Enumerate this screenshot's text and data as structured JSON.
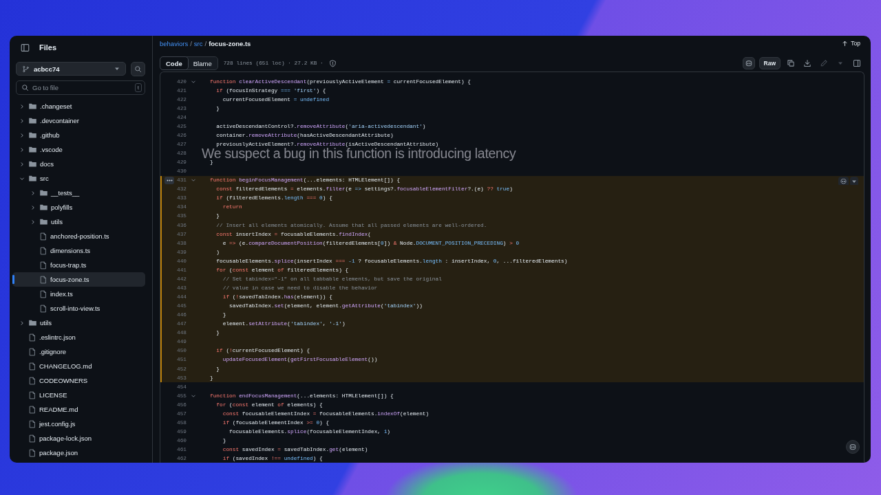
{
  "sidebar": {
    "title": "Files",
    "branch": "acbcc74",
    "search": {
      "placeholder": "Go to file"
    },
    "shortcut": "t",
    "tree": [
      {
        "name": ".changeset",
        "kind": "folder",
        "expanded": false,
        "selected": false
      },
      {
        "name": ".devcontainer",
        "kind": "folder",
        "expanded": false,
        "selected": false
      },
      {
        "name": ".github",
        "kind": "folder",
        "expanded": false,
        "selected": false
      },
      {
        "name": ".vscode",
        "kind": "folder",
        "expanded": false,
        "selected": false
      },
      {
        "name": "docs",
        "kind": "folder",
        "expanded": false,
        "selected": false
      },
      {
        "name": "src",
        "kind": "folder",
        "expanded": true,
        "selected": false,
        "children": [
          {
            "name": "__tests__",
            "kind": "folder",
            "expanded": false,
            "selected": false
          },
          {
            "name": "polyfills",
            "kind": "folder",
            "expanded": false,
            "selected": false
          },
          {
            "name": "utils",
            "kind": "folder",
            "expanded": false,
            "selected": false
          },
          {
            "name": "anchored-position.ts",
            "kind": "file",
            "selected": false
          },
          {
            "name": "dimensions.ts",
            "kind": "file",
            "selected": false
          },
          {
            "name": "focus-trap.ts",
            "kind": "file",
            "selected": false
          },
          {
            "name": "focus-zone.ts",
            "kind": "file",
            "selected": true
          },
          {
            "name": "index.ts",
            "kind": "file",
            "selected": false
          },
          {
            "name": "scroll-into-view.ts",
            "kind": "file",
            "selected": false
          }
        ]
      },
      {
        "name": "utils",
        "kind": "folder",
        "expanded": false,
        "selected": false
      },
      {
        "name": ".eslintrc.json",
        "kind": "file",
        "selected": false
      },
      {
        "name": ".gitignore",
        "kind": "file",
        "selected": false
      },
      {
        "name": "CHANGELOG.md",
        "kind": "file",
        "selected": false
      },
      {
        "name": "CODEOWNERS",
        "kind": "file",
        "selected": false
      },
      {
        "name": "LICENSE",
        "kind": "file",
        "selected": false
      },
      {
        "name": "README.md",
        "kind": "file",
        "selected": false
      },
      {
        "name": "jest.config.js",
        "kind": "file",
        "selected": false
      },
      {
        "name": "package-lock.json",
        "kind": "file",
        "selected": false
      },
      {
        "name": "package.json",
        "kind": "file",
        "selected": false
      }
    ]
  },
  "breadcrumb": [
    {
      "text": "behaviors",
      "kind": "link"
    },
    {
      "text": "/",
      "kind": "sep"
    },
    {
      "text": "src",
      "kind": "link"
    },
    {
      "text": "/",
      "kind": "sep"
    },
    {
      "text": "focus-zone.ts",
      "kind": "current"
    }
  ],
  "top_link": "Top",
  "toolbar": {
    "tabs": [
      {
        "label": "Code",
        "selected": true
      },
      {
        "label": "Blame",
        "selected": false
      }
    ],
    "file_info": "728 lines (651 loc) · 27.2 KB ·",
    "raw_button": "Raw",
    "edit_disabled": true
  },
  "code": {
    "caption": "We suspect a bug in this function is introducing latency",
    "lines": [
      {
        "number": "420",
        "foldable": true,
        "highlighted": false,
        "tokens": [
          {
            "text": "function ",
            "kind": "keyword"
          },
          {
            "text": "clearActiveDescendant",
            "kind": "func"
          },
          {
            "text": "(previouslyActiveElement ",
            "kind": "plain"
          },
          {
            "text": "= ",
            "kind": "const"
          },
          {
            "text": "currentFocusedElement) {",
            "kind": "plain"
          }
        ]
      },
      {
        "number": "421",
        "foldable": false,
        "highlighted": false,
        "tokens": [
          {
            "text": "  if",
            "kind": "keyword"
          },
          {
            "text": " (focusInStrategy ",
            "kind": "plain"
          },
          {
            "text": "=== ",
            "kind": "const"
          },
          {
            "text": "'first'",
            "kind": "string"
          },
          {
            "text": ") {",
            "kind": "plain"
          }
        ]
      },
      {
        "number": "422",
        "foldable": false,
        "highlighted": false,
        "tokens": [
          {
            "text": "    currentFocusedElement ",
            "kind": "plain"
          },
          {
            "text": "= undefined",
            "kind": "const"
          }
        ]
      },
      {
        "number": "423",
        "foldable": false,
        "highlighted": false,
        "tokens": [
          {
            "text": "  }",
            "kind": "plain"
          }
        ]
      },
      {
        "number": "424",
        "foldable": false,
        "highlighted": false
      },
      {
        "number": "425",
        "foldable": false,
        "highlighted": false,
        "tokens": [
          {
            "text": "  activeDescendantControl?.",
            "kind": "plain"
          },
          {
            "text": "removeAttribute",
            "kind": "func"
          },
          {
            "text": "(",
            "kind": "plain"
          },
          {
            "text": "'aria-activedescendant'",
            "kind": "string"
          },
          {
            "text": ")",
            "kind": "plain"
          }
        ]
      },
      {
        "number": "426",
        "foldable": false,
        "highlighted": false,
        "tokens": [
          {
            "text": "  container.",
            "kind": "plain"
          },
          {
            "text": "removeAttribute",
            "kind": "func"
          },
          {
            "text": "(hasActiveDescendantAttribute)",
            "kind": "plain"
          }
        ]
      },
      {
        "number": "427",
        "foldable": false,
        "highlighted": false,
        "tokens": [
          {
            "text": "  previouslyActiveElement?.",
            "kind": "plain"
          },
          {
            "text": "removeAttribute",
            "kind": "func"
          },
          {
            "text": "(isActiveDescendantAttribute)",
            "kind": "plain"
          }
        ]
      },
      {
        "number": "428",
        "foldable": false,
        "highlighted": false
      },
      {
        "number": "429",
        "foldable": false,
        "highlighted": false,
        "tokens": [
          {
            "text": "}",
            "kind": "plain"
          }
        ]
      },
      {
        "number": "430",
        "foldable": false,
        "highlighted": false
      },
      {
        "number": "431",
        "foldable": true,
        "highlighted": true,
        "tokens": [
          {
            "text": "function ",
            "kind": "keyword"
          },
          {
            "text": "beginFocusManagement",
            "kind": "func"
          },
          {
            "text": "(...elements: HTMLElement[]) {",
            "kind": "plain"
          }
        ]
      },
      {
        "number": "432",
        "foldable": false,
        "highlighted": true,
        "tokens": [
          {
            "text": "  const",
            "kind": "keyword"
          },
          {
            "text": " filteredElements ",
            "kind": "plain"
          },
          {
            "text": "=",
            "kind": "keyword"
          },
          {
            "text": " elements.",
            "kind": "plain"
          },
          {
            "text": "filter",
            "kind": "func"
          },
          {
            "text": "(e ",
            "kind": "plain"
          },
          {
            "text": "=>",
            "kind": "const"
          },
          {
            "text": " settings?.",
            "kind": "plain"
          },
          {
            "text": "focusableElementFilter",
            "kind": "func"
          },
          {
            "text": "?.(e) ",
            "kind": "plain"
          },
          {
            "text": "??",
            "kind": "keyword"
          },
          {
            "text": " true",
            "kind": "const"
          },
          {
            "text": ")",
            "kind": "plain"
          }
        ]
      },
      {
        "number": "433",
        "foldable": false,
        "highlighted": true,
        "tokens": [
          {
            "text": "  if",
            "kind": "keyword"
          },
          {
            "text": " (filteredElements.",
            "kind": "plain"
          },
          {
            "text": "length",
            "kind": "const"
          },
          {
            "text": " ===",
            "kind": "keyword"
          },
          {
            "text": " 0",
            "kind": "const"
          },
          {
            "text": ") {",
            "kind": "plain"
          }
        ]
      },
      {
        "number": "434",
        "foldable": false,
        "highlighted": true,
        "tokens": [
          {
            "text": "    return",
            "kind": "keyword"
          }
        ]
      },
      {
        "number": "435",
        "foldable": false,
        "highlighted": true,
        "tokens": [
          {
            "text": "  }",
            "kind": "plain"
          }
        ]
      },
      {
        "number": "436",
        "foldable": false,
        "highlighted": true,
        "tokens": [
          {
            "text": "  // Insert all elements atomically. Assume that all passed elements are well-ordered.",
            "kind": "comment"
          }
        ]
      },
      {
        "number": "437",
        "foldable": false,
        "highlighted": true,
        "tokens": [
          {
            "text": "  const",
            "kind": "keyword"
          },
          {
            "text": " insertIndex ",
            "kind": "plain"
          },
          {
            "text": "=",
            "kind": "keyword"
          },
          {
            "text": " focusableElements.",
            "kind": "plain"
          },
          {
            "text": "findIndex",
            "kind": "func"
          },
          {
            "text": "(",
            "kind": "plain"
          }
        ]
      },
      {
        "number": "438",
        "foldable": false,
        "highlighted": true,
        "tokens": [
          {
            "text": "    e ",
            "kind": "plain"
          },
          {
            "text": "=>",
            "kind": "keyword"
          },
          {
            "text": " (e.",
            "kind": "plain"
          },
          {
            "text": "compareDocumentPosition",
            "kind": "func"
          },
          {
            "text": "(filteredElements[",
            "kind": "plain"
          },
          {
            "text": "0",
            "kind": "const"
          },
          {
            "text": "]) ",
            "kind": "plain"
          },
          {
            "text": "&",
            "kind": "keyword"
          },
          {
            "text": " Node.",
            "kind": "plain"
          },
          {
            "text": "DOCUMENT_POSITION_PRECEDING",
            "kind": "const"
          },
          {
            "text": ") ",
            "kind": "plain"
          },
          {
            "text": ">",
            "kind": "keyword"
          },
          {
            "text": " 0",
            "kind": "const"
          }
        ]
      },
      {
        "number": "439",
        "foldable": false,
        "highlighted": true,
        "tokens": [
          {
            "text": "  )",
            "kind": "plain"
          }
        ]
      },
      {
        "number": "440",
        "foldable": false,
        "highlighted": true,
        "tokens": [
          {
            "text": "  focusableElements.",
            "kind": "plain"
          },
          {
            "text": "splice",
            "kind": "func"
          },
          {
            "text": "(insertIndex ",
            "kind": "plain"
          },
          {
            "text": "===",
            "kind": "keyword"
          },
          {
            "text": " -1",
            "kind": "const"
          },
          {
            "text": " ? focusableElements.",
            "kind": "plain"
          },
          {
            "text": "length",
            "kind": "const"
          },
          {
            "text": " : insertIndex, ",
            "kind": "plain"
          },
          {
            "text": "0",
            "kind": "const"
          },
          {
            "text": ", ...filteredElements)",
            "kind": "plain"
          }
        ]
      },
      {
        "number": "441",
        "foldable": false,
        "highlighted": true,
        "tokens": [
          {
            "text": "  for",
            "kind": "keyword"
          },
          {
            "text": " (",
            "kind": "plain"
          },
          {
            "text": "const",
            "kind": "keyword"
          },
          {
            "text": " element ",
            "kind": "plain"
          },
          {
            "text": "of",
            "kind": "keyword"
          },
          {
            "text": " filteredElements) {",
            "kind": "plain"
          }
        ]
      },
      {
        "number": "442",
        "foldable": false,
        "highlighted": true,
        "tokens": [
          {
            "text": "    // Set tabindex=\"-1\" on all tabbable elements, but save the original",
            "kind": "comment"
          }
        ]
      },
      {
        "number": "443",
        "foldable": false,
        "highlighted": true,
        "tokens": [
          {
            "text": "    // value in case we need to disable the behavior",
            "kind": "comment"
          }
        ]
      },
      {
        "number": "444",
        "foldable": false,
        "highlighted": true,
        "tokens": [
          {
            "text": "    if",
            "kind": "keyword"
          },
          {
            "text": " (",
            "kind": "plain"
          },
          {
            "text": "!",
            "kind": "keyword"
          },
          {
            "text": "savedTabIndex.",
            "kind": "plain"
          },
          {
            "text": "has",
            "kind": "func"
          },
          {
            "text": "(element)) {",
            "kind": "plain"
          }
        ]
      },
      {
        "number": "445",
        "foldable": false,
        "highlighted": true,
        "tokens": [
          {
            "text": "      savedTabIndex.",
            "kind": "plain"
          },
          {
            "text": "set",
            "kind": "func"
          },
          {
            "text": "(element, element.",
            "kind": "plain"
          },
          {
            "text": "getAttribute",
            "kind": "func"
          },
          {
            "text": "(",
            "kind": "plain"
          },
          {
            "text": "'tabindex'",
            "kind": "string"
          },
          {
            "text": "))",
            "kind": "plain"
          }
        ]
      },
      {
        "number": "446",
        "foldable": false,
        "highlighted": true,
        "tokens": [
          {
            "text": "    }",
            "kind": "plain"
          }
        ]
      },
      {
        "number": "447",
        "foldable": false,
        "highlighted": true,
        "tokens": [
          {
            "text": "    element.",
            "kind": "plain"
          },
          {
            "text": "setAttribute",
            "kind": "func"
          },
          {
            "text": "(",
            "kind": "plain"
          },
          {
            "text": "'tabindex'",
            "kind": "string"
          },
          {
            "text": ", ",
            "kind": "plain"
          },
          {
            "text": "'-1'",
            "kind": "string"
          },
          {
            "text": ")",
            "kind": "plain"
          }
        ]
      },
      {
        "number": "448",
        "foldable": false,
        "highlighted": true,
        "tokens": [
          {
            "text": "  }",
            "kind": "plain"
          }
        ]
      },
      {
        "number": "449",
        "foldable": false,
        "highlighted": true
      },
      {
        "number": "450",
        "foldable": false,
        "highlighted": true,
        "tokens": [
          {
            "text": "  if",
            "kind": "keyword"
          },
          {
            "text": " (",
            "kind": "plain"
          },
          {
            "text": "!",
            "kind": "keyword"
          },
          {
            "text": "currentFocusedElement) {",
            "kind": "plain"
          }
        ]
      },
      {
        "number": "451",
        "foldable": false,
        "highlighted": true,
        "tokens": [
          {
            "text": "    updateFocusedElement",
            "kind": "func"
          },
          {
            "text": "(",
            "kind": "plain"
          },
          {
            "text": "getFirstFocusableElement",
            "kind": "func"
          },
          {
            "text": "())",
            "kind": "plain"
          }
        ]
      },
      {
        "number": "452",
        "foldable": false,
        "highlighted": true,
        "tokens": [
          {
            "text": "  }",
            "kind": "plain"
          }
        ]
      },
      {
        "number": "453",
        "foldable": false,
        "highlighted": true,
        "tokens": [
          {
            "text": "}",
            "kind": "plain"
          }
        ]
      },
      {
        "number": "454",
        "foldable": false,
        "highlighted": false
      },
      {
        "number": "455",
        "foldable": true,
        "highlighted": false,
        "tokens": [
          {
            "text": "function ",
            "kind": "keyword"
          },
          {
            "text": "endFocusManagement",
            "kind": "func"
          },
          {
            "text": "(...elements: HTMLElement[]) {",
            "kind": "plain"
          }
        ]
      },
      {
        "number": "456",
        "foldable": false,
        "highlighted": false,
        "tokens": [
          {
            "text": "  for",
            "kind": "keyword"
          },
          {
            "text": " (",
            "kind": "plain"
          },
          {
            "text": "const",
            "kind": "keyword"
          },
          {
            "text": " element ",
            "kind": "plain"
          },
          {
            "text": "of",
            "kind": "keyword"
          },
          {
            "text": " elements) {",
            "kind": "plain"
          }
        ]
      },
      {
        "number": "457",
        "foldable": false,
        "highlighted": false,
        "tokens": [
          {
            "text": "    const",
            "kind": "keyword"
          },
          {
            "text": " focusableElementIndex ",
            "kind": "plain"
          },
          {
            "text": "=",
            "kind": "keyword"
          },
          {
            "text": " focusableElements.",
            "kind": "plain"
          },
          {
            "text": "indexOf",
            "kind": "func"
          },
          {
            "text": "(element)",
            "kind": "plain"
          }
        ]
      },
      {
        "number": "458",
        "foldable": false,
        "highlighted": false,
        "tokens": [
          {
            "text": "    if",
            "kind": "keyword"
          },
          {
            "text": " (focusableElementIndex ",
            "kind": "plain"
          },
          {
            "text": ">=",
            "kind": "keyword"
          },
          {
            "text": " 0",
            "kind": "const"
          },
          {
            "text": ") {",
            "kind": "plain"
          }
        ]
      },
      {
        "number": "459",
        "foldable": false,
        "highlighted": false,
        "tokens": [
          {
            "text": "      focusableElements.",
            "kind": "plain"
          },
          {
            "text": "splice",
            "kind": "func"
          },
          {
            "text": "(focusableElementIndex, ",
            "kind": "plain"
          },
          {
            "text": "1",
            "kind": "const"
          },
          {
            "text": ")",
            "kind": "plain"
          }
        ]
      },
      {
        "number": "460",
        "foldable": false,
        "highlighted": false,
        "tokens": [
          {
            "text": "    }",
            "kind": "plain"
          }
        ]
      },
      {
        "number": "461",
        "foldable": false,
        "highlighted": false,
        "tokens": [
          {
            "text": "    const",
            "kind": "keyword"
          },
          {
            "text": " savedIndex ",
            "kind": "plain"
          },
          {
            "text": "=",
            "kind": "keyword"
          },
          {
            "text": " savedTabIndex.",
            "kind": "plain"
          },
          {
            "text": "get",
            "kind": "func"
          },
          {
            "text": "(element)",
            "kind": "plain"
          }
        ]
      },
      {
        "number": "462",
        "foldable": false,
        "highlighted": false,
        "tokens": [
          {
            "text": "    if",
            "kind": "keyword"
          },
          {
            "text": " (savedIndex ",
            "kind": "plain"
          },
          {
            "text": "!==",
            "kind": "keyword"
          },
          {
            "text": " undefined",
            "kind": "const"
          },
          {
            "text": ") {",
            "kind": "plain"
          }
        ]
      }
    ]
  }
}
